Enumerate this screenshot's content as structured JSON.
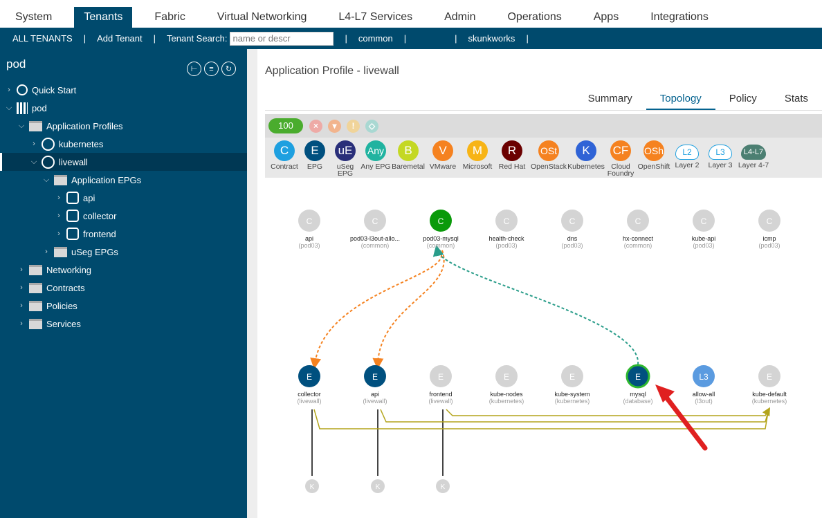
{
  "topnav": {
    "tabs": [
      "System",
      "Tenants",
      "Fabric",
      "Virtual Networking",
      "L4-L7 Services",
      "Admin",
      "Operations",
      "Apps",
      "Integrations"
    ],
    "selected": "Tenants"
  },
  "subnav": {
    "all": "ALL TENANTS",
    "add": "Add Tenant",
    "search_label": "Tenant Search:",
    "search_placeholder": "name or descr",
    "t1": "common",
    "t2": "skunkworks"
  },
  "sidebar": {
    "title": "pod",
    "tree": [
      {
        "label": "Quick Start",
        "level": 0,
        "icon": "quick-start-icon",
        "exp": false
      },
      {
        "label": "pod",
        "level": 0,
        "icon": "tenant-building-icon",
        "exp": true
      },
      {
        "label": "Application Profiles",
        "level": 1,
        "icon": "folder-icon",
        "exp": true
      },
      {
        "label": "kubernetes",
        "level": 2,
        "icon": "app-profile-icon",
        "exp": false
      },
      {
        "label": "livewall",
        "level": 2,
        "icon": "app-profile-icon",
        "exp": true,
        "selected": true
      },
      {
        "label": "Application EPGs",
        "level": 3,
        "icon": "folder-icon",
        "exp": true
      },
      {
        "label": "api",
        "level": 4,
        "icon": "epg-icon",
        "exp": false
      },
      {
        "label": "collector",
        "level": 4,
        "icon": "epg-icon",
        "exp": false
      },
      {
        "label": "frontend",
        "level": 4,
        "icon": "epg-icon",
        "exp": false
      },
      {
        "label": "uSeg EPGs",
        "level": 3,
        "icon": "folder-icon",
        "exp": false
      },
      {
        "label": "Networking",
        "level": 1,
        "icon": "folder-icon",
        "exp": false
      },
      {
        "label": "Contracts",
        "level": 1,
        "icon": "folder-icon",
        "exp": false
      },
      {
        "label": "Policies",
        "level": 1,
        "icon": "folder-icon",
        "exp": false
      },
      {
        "label": "Services",
        "level": 1,
        "icon": "folder-icon",
        "exp": false
      }
    ]
  },
  "main": {
    "title": "Application Profile - livewall",
    "tabs": [
      "Summary",
      "Topology",
      "Policy",
      "Stats"
    ],
    "selected_tab": "Topology",
    "health": "100",
    "legend": [
      {
        "g": "C",
        "l": "Contract",
        "c": "#1ea0e0"
      },
      {
        "g": "E",
        "l": "EPG",
        "c": "#00507f"
      },
      {
        "g": "uE",
        "l": "uSeg EPG",
        "c": "#2a2f7a"
      },
      {
        "g": "Any",
        "l": "Any EPG",
        "c": "#20b3a0"
      },
      {
        "g": "B",
        "l": "Baremetal",
        "c": "#c4d824"
      },
      {
        "g": "V",
        "l": "VMware",
        "c": "#f58220"
      },
      {
        "g": "M",
        "l": "Microsoft",
        "c": "#f7b416"
      },
      {
        "g": "R",
        "l": "Red Hat",
        "c": "#6b0000"
      },
      {
        "g": "OSt",
        "l": "OpenStack",
        "c": "#f58220"
      },
      {
        "g": "K",
        "l": "Kubernetes",
        "c": "#2f63d6"
      },
      {
        "g": "CF",
        "l": "Cloud Foundry",
        "c": "#f58220"
      },
      {
        "g": "OSh",
        "l": "OpenShift",
        "c": "#f58220"
      },
      {
        "g": "L2",
        "l": "Layer 2",
        "c": "#ffffff"
      },
      {
        "g": "L3",
        "l": "Layer 3",
        "c": "#ffffff"
      },
      {
        "g": "L4-L7",
        "l": "Layer 4-7",
        "c": "#4c7f72"
      }
    ]
  },
  "topology": {
    "contracts": [
      {
        "n": "api",
        "s": "(pod03)"
      },
      {
        "n": "pod03-l3out-allo...",
        "s": "(common)"
      },
      {
        "n": "pod03-mysql",
        "s": "(common)",
        "active": true
      },
      {
        "n": "health-check",
        "s": "(pod03)"
      },
      {
        "n": "dns",
        "s": "(pod03)"
      },
      {
        "n": "hx-connect",
        "s": "(common)"
      },
      {
        "n": "kube-api",
        "s": "(pod03)"
      },
      {
        "n": "icmp",
        "s": "(pod03)"
      }
    ],
    "epgs": [
      {
        "n": "collector",
        "s": "(livewall)",
        "active": true
      },
      {
        "n": "api",
        "s": "(livewall)",
        "active": true
      },
      {
        "n": "frontend",
        "s": "(livewall)"
      },
      {
        "n": "kube-nodes",
        "s": "(kubernetes)"
      },
      {
        "n": "kube-system",
        "s": "(kubernetes)"
      },
      {
        "n": "mysql",
        "s": "(database)",
        "active": true,
        "highlight": true
      },
      {
        "n": "allow-all",
        "s": "(l3out)",
        "l3": true
      },
      {
        "n": "kube-default",
        "s": "(kubernetes)"
      }
    ],
    "k_glyph": "K",
    "contract_glyph": "C",
    "epg_glyph": "E",
    "l3_glyph": "L3"
  }
}
